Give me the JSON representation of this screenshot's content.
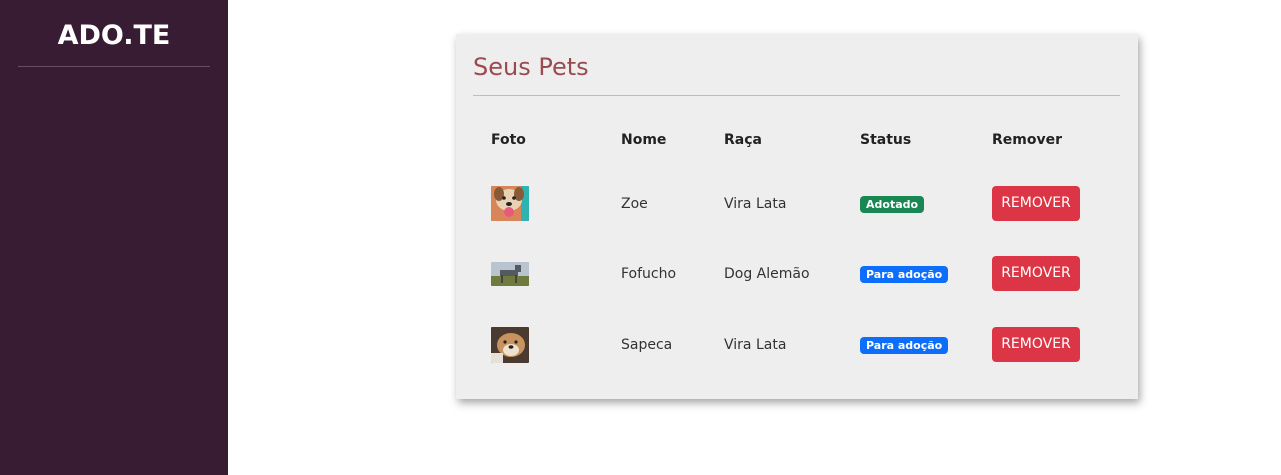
{
  "sidebar": {
    "brand": "ADO.TE"
  },
  "card": {
    "title": "Seus Pets",
    "headers": {
      "foto": "Foto",
      "nome": "Nome",
      "raca": "Raça",
      "status": "Status",
      "remover": "Remover"
    },
    "rows": [
      {
        "photo": "dog-photo-icon",
        "nome": "Zoe",
        "raca": "Vira Lata",
        "status": "Adotado",
        "status_color": "#198754",
        "button": "REMOVER"
      },
      {
        "photo": "dog-photo-icon",
        "nome": "Fofucho",
        "raca": "Dog Alemão",
        "status": "Para adoção",
        "status_color": "#0d6efd",
        "button": "REMOVER"
      },
      {
        "photo": "dog-photo-icon",
        "nome": "Sapeca",
        "raca": "Vira Lata",
        "status": "Para adoção",
        "status_color": "#0d6efd",
        "button": "REMOVER"
      }
    ]
  },
  "colors": {
    "sidebar": "#381c33",
    "title": "#9b4a4f",
    "remove_button": "#dc3545"
  }
}
